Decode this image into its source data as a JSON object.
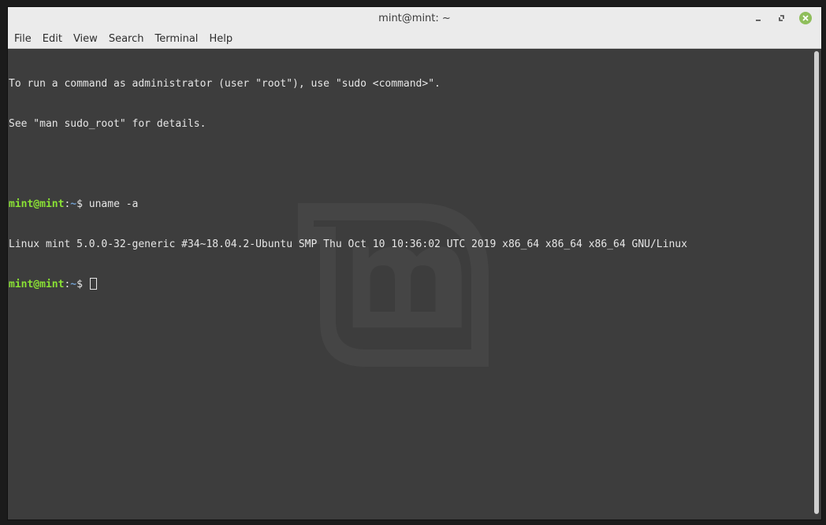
{
  "window": {
    "title": "mint@mint: ~"
  },
  "menu": {
    "items": [
      "File",
      "Edit",
      "View",
      "Search",
      "Terminal",
      "Help"
    ]
  },
  "terminal": {
    "intro_line1": "To run a command as administrator (user \"root\"), use \"sudo <command>\".",
    "intro_line2": "See \"man sudo_root\" for details.",
    "prompt_user": "mint@mint",
    "prompt_sep": ":",
    "prompt_path": "~",
    "prompt_symbol": "$ ",
    "command1": "uname -a",
    "output1": "Linux mint 5.0.0-32-generic #34~18.04.2-Ubuntu SMP Thu Oct 10 10:36:02 UTC 2019 x86_64 x86_64 x86_64 GNU/Linux"
  },
  "colors": {
    "prompt_user": "#8ae234",
    "prompt_path": "#729fcf",
    "background": "#3d3d3d",
    "close_button": "#8fbe5b"
  },
  "icons": {
    "minimize": "minimize-icon",
    "maximize": "maximize-icon",
    "close": "close-icon",
    "watermark": "linux-mint-logo"
  }
}
